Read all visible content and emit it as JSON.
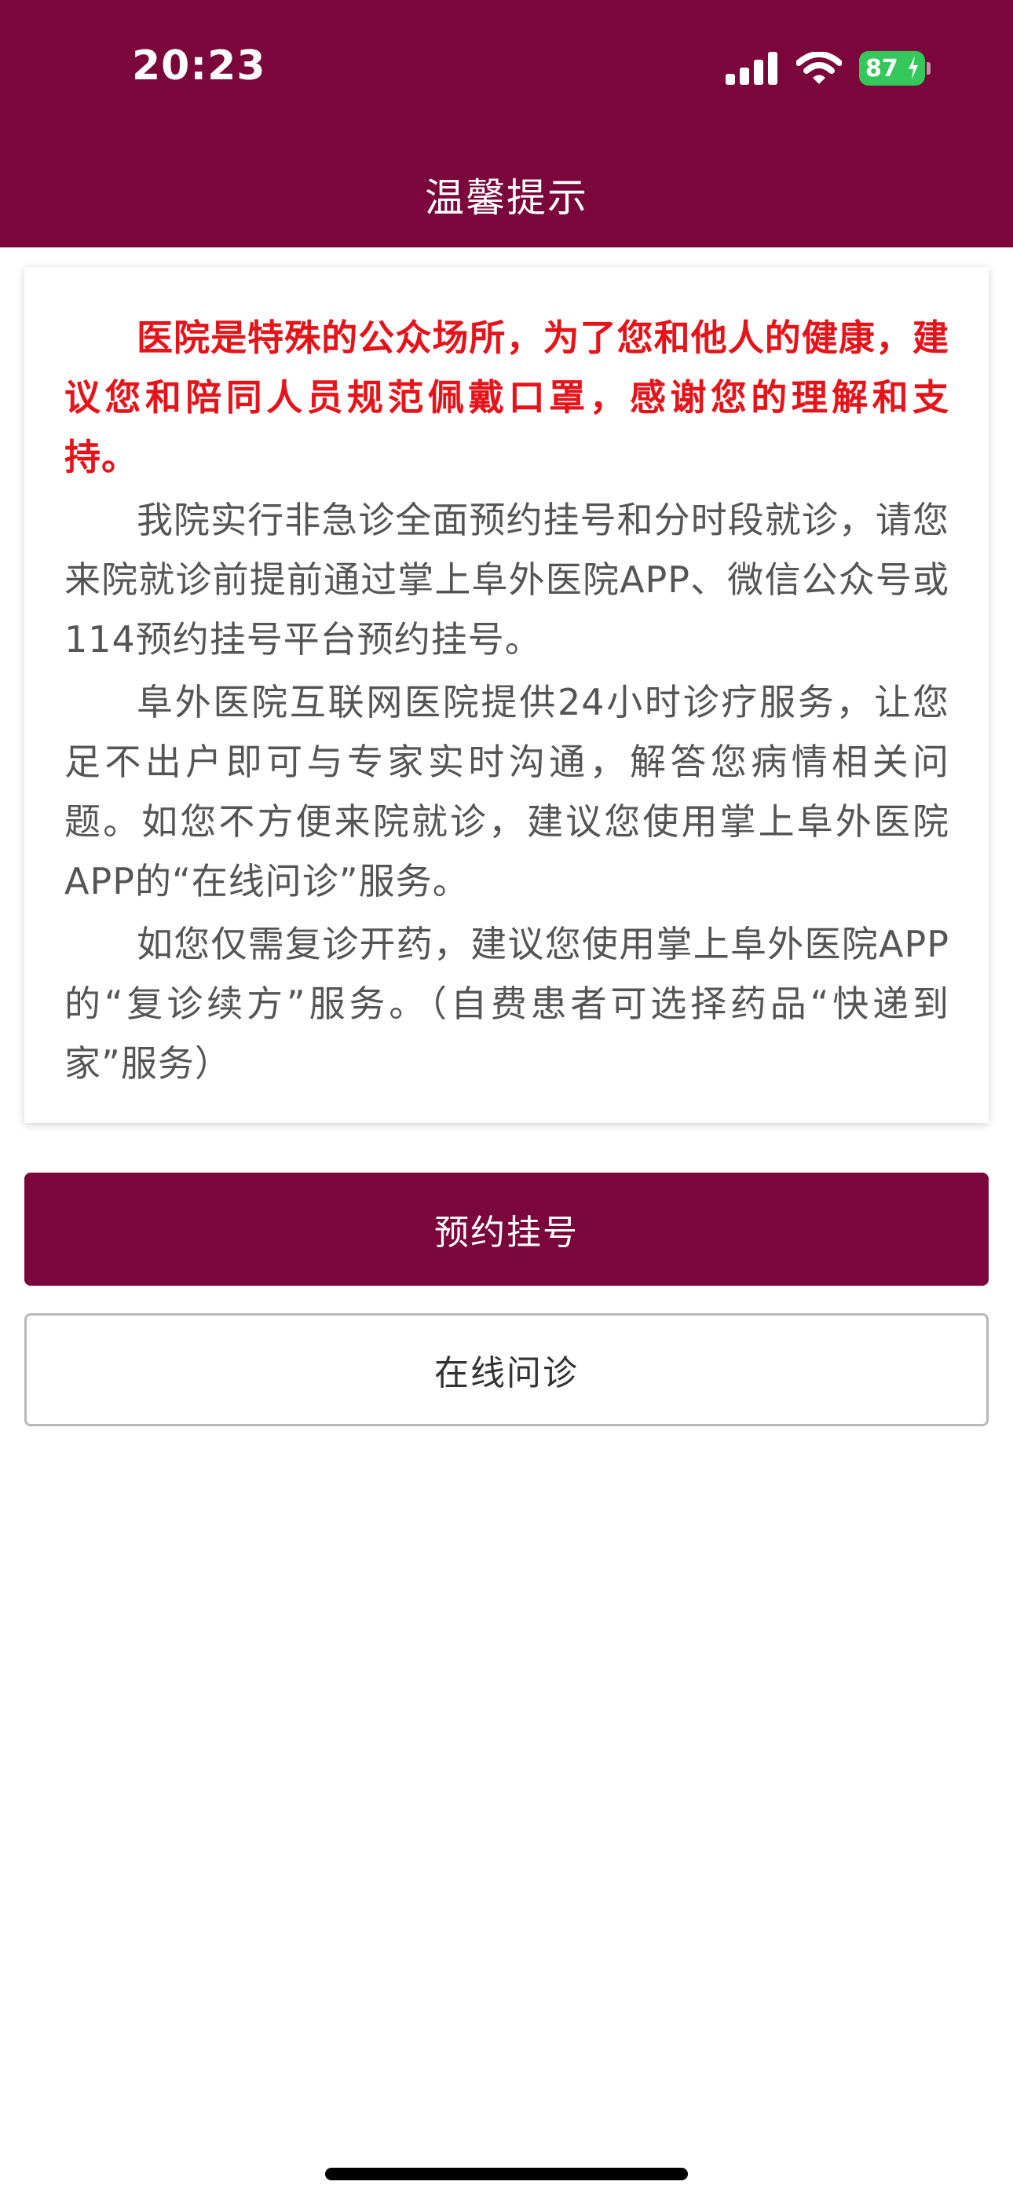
{
  "status_bar": {
    "time": "20:23",
    "battery": "87",
    "icons": [
      "cellular-signal-icon",
      "wifi-icon",
      "battery-icon",
      "charging-bolt-icon"
    ]
  },
  "header": {
    "title": "温馨提示"
  },
  "notice": {
    "alert": "医院是特殊的公众场所，为了您和他人的健康，建议您和陪同人员规范佩戴口罩，感谢您的理解和支持。",
    "para_appointment": "我院实行非急诊全面预约挂号和分时段就诊，请您来院就诊前提前通过掌上阜外医院APP、微信公众号或114预约挂号平台预约挂号。",
    "para_internet_hospital": "阜外医院互联网医院提供24小时诊疗服务，让您足不出户即可与专家实时沟通，解答您病情相关问题。如您不方便来院就诊，建议您使用掌上阜外医院APP的“在线问诊”服务。",
    "para_prescription": "如您仅需复诊开药，建议您使用掌上阜外医院APP的“复诊续方”服务。（自费患者可选择药品“快递到家”服务）"
  },
  "actions": {
    "book_label": "预约挂号",
    "consult_label": "在线问诊"
  },
  "colors": {
    "brand": "#7a063c",
    "alert_text": "#e5141a",
    "body_text": "#555555",
    "battery": "#34c759"
  }
}
